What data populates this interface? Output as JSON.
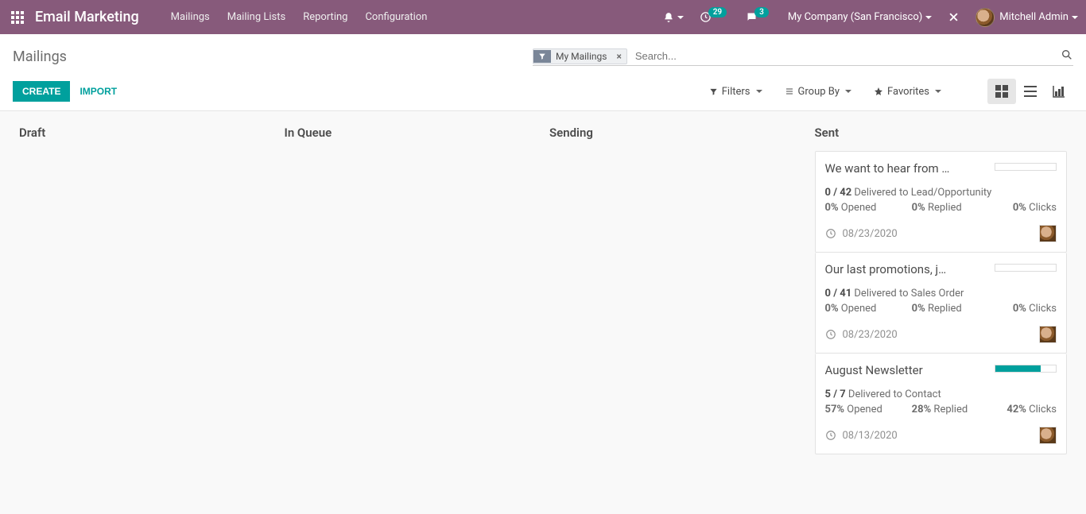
{
  "header": {
    "app_title": "Email Marketing",
    "menu": [
      "Mailings",
      "Mailing Lists",
      "Reporting",
      "Configuration"
    ],
    "activities_badge": "29",
    "messages_badge": "3",
    "company": "My Company (San Francisco)",
    "user": "Mitchell Admin"
  },
  "control_panel": {
    "breadcrumb": "Mailings",
    "facet_label": "My Mailings",
    "search_placeholder": "Search...",
    "create_label": "Create",
    "import_label": "Import",
    "filters_label": "Filters",
    "groupby_label": "Group By",
    "favorites_label": "Favorites"
  },
  "columns": {
    "draft": "Draft",
    "in_queue": "In Queue",
    "sending": "Sending",
    "sent": "Sent"
  },
  "cards": [
    {
      "title": "We want to hear from …",
      "progress_pct": 0,
      "delivered_ratio": "0 / 42",
      "delivered_text": " Delivered to Lead/Opportunity",
      "opened_pct": "0%",
      "opened_label": " Opened",
      "replied_pct": "0%",
      "replied_label": " Replied",
      "clicks_pct": "0%",
      "clicks_label": " Clicks",
      "date": "08/23/2020"
    },
    {
      "title": "Our last promotions, j…",
      "progress_pct": 0,
      "delivered_ratio": "0 / 41",
      "delivered_text": " Delivered to Sales Order",
      "opened_pct": "0%",
      "opened_label": " Opened",
      "replied_pct": "0%",
      "replied_label": " Replied",
      "clicks_pct": "0%",
      "clicks_label": " Clicks",
      "date": "08/23/2020"
    },
    {
      "title": "August Newsletter",
      "progress_pct": 75,
      "delivered_ratio": "5 / 7",
      "delivered_text": " Delivered to Contact",
      "opened_pct": "57%",
      "opened_label": " Opened",
      "replied_pct": "28%",
      "replied_label": " Replied",
      "clicks_pct": "42%",
      "clicks_label": " Clicks",
      "date": "08/13/2020"
    }
  ]
}
